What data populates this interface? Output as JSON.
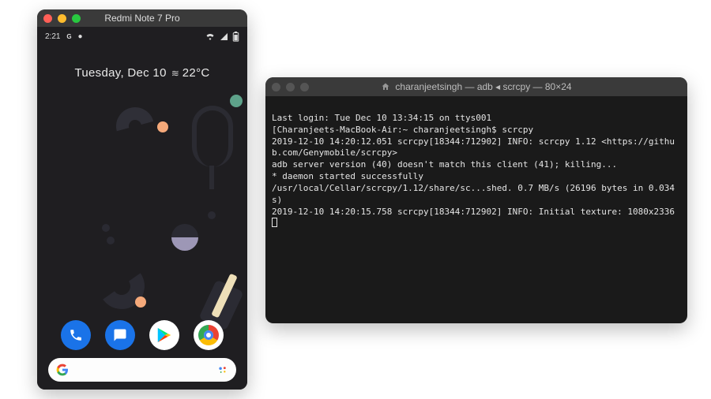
{
  "phone": {
    "window_title": "Redmi Note 7 Pro",
    "status": {
      "time": "2:21",
      "google_badge": "G",
      "dot": "●"
    },
    "date_label": "Tuesday, Dec 10",
    "weather": "22°C",
    "dock": {
      "phone": "Phone",
      "messages": "Messages",
      "play": "Play Store",
      "chrome": "Chrome"
    },
    "search_placeholder": ""
  },
  "terminal": {
    "title": "charanjeetsingh — adb ◂ scrcpy — 80×24",
    "lines": [
      "Last login: Tue Dec 10 13:34:15 on ttys001",
      "[Charanjeets-MacBook-Air:~ charanjeetsingh$ scrcpy",
      "2019-12-10 14:20:12.051 scrcpy[18344:712902] INFO: scrcpy 1.12 <https://github.com/Genymobile/scrcpy>",
      "adb server version (40) doesn't match this client (41); killing...",
      "* daemon started successfully",
      "/usr/local/Cellar/scrcpy/1.12/share/sc...shed. 0.7 MB/s (26196 bytes in 0.034s)",
      "2019-12-10 14:20:15.758 scrcpy[18344:712902] INFO: Initial texture: 1080x2336"
    ]
  }
}
